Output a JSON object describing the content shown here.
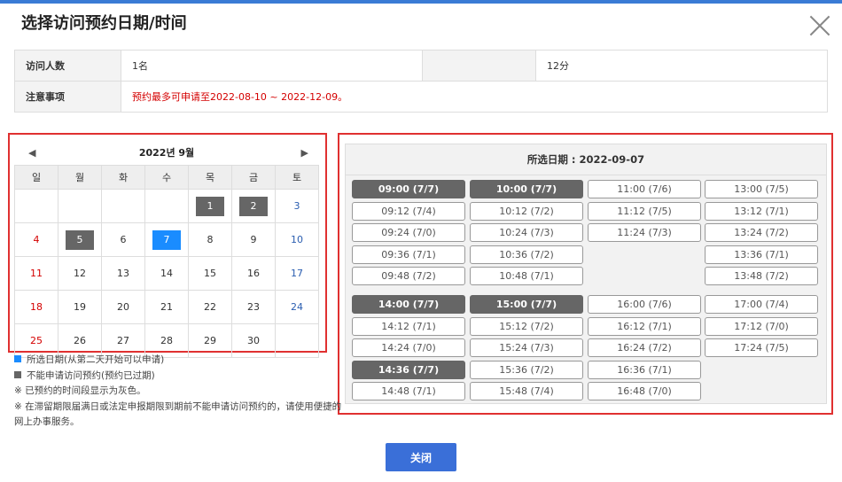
{
  "dialog": {
    "title": "选择访问预约日期/时间"
  },
  "info": {
    "visitors_label": "访问人数",
    "visitors_value": "1名",
    "duration_value": "12分",
    "notes_label": "注意事项",
    "notes_value": "预约最多可申请至2022-08-10 ~ 2022-12-09。"
  },
  "calendar": {
    "prev": "◀",
    "next": "▶",
    "month_title": "2022년 9월",
    "weekdays": [
      "일",
      "월",
      "화",
      "수",
      "목",
      "금",
      "토"
    ],
    "weeks": [
      [
        "",
        "",
        "",
        "",
        "1",
        "2",
        "3"
      ],
      [
        "4",
        "5",
        "6",
        "7",
        "8",
        "9",
        "10"
      ],
      [
        "11",
        "12",
        "13",
        "14",
        "15",
        "16",
        "17"
      ],
      [
        "18",
        "19",
        "20",
        "21",
        "22",
        "23",
        "24"
      ],
      [
        "25",
        "26",
        "27",
        "28",
        "29",
        "30",
        ""
      ]
    ]
  },
  "legend": {
    "selected": "所选日期(从第二天开始可以申请)",
    "unavailable": "不能申请访问预约(预约已过期)",
    "note1": "※ 已预约的时间段显示为灰色。",
    "note2": "※ 在滞留期限届满日或法定申报期限到期前不能申请访问预约的，请使用便捷的网上办事服务。"
  },
  "slots": {
    "header": "所选日期 : 2022-09-07",
    "group1": [
      [
        "09:00 (7/7)",
        "09:12 (7/4)",
        "09:24 (7/0)",
        "09:36 (7/1)",
        "09:48 (7/2)"
      ],
      [
        "10:00 (7/7)",
        "10:12 (7/2)",
        "10:24 (7/3)",
        "10:36 (7/2)",
        "10:48 (7/1)"
      ],
      [
        "11:00 (7/6)",
        "11:12 (7/5)",
        "11:24 (7/3)"
      ],
      [
        "13:00 (7/5)",
        "13:12 (7/1)",
        "13:24 (7/2)",
        "13:36 (7/1)",
        "13:48 (7/2)"
      ]
    ],
    "group2": [
      [
        "14:00 (7/7)",
        "14:12 (7/1)",
        "14:24 (7/0)",
        "14:36 (7/7)",
        "14:48 (7/1)"
      ],
      [
        "15:00 (7/7)",
        "15:12 (7/2)",
        "15:24 (7/3)",
        "15:36 (7/2)",
        "15:48 (7/4)"
      ],
      [
        "16:00 (7/6)",
        "16:12 (7/1)",
        "16:24 (7/2)",
        "16:36 (7/1)",
        "16:48 (7/0)"
      ],
      [
        "17:00 (7/4)",
        "17:12 (7/0)",
        "17:24 (7/5)"
      ]
    ]
  },
  "footer": {
    "close_label": "关闭"
  },
  "colors": {
    "accent": "#3a6fd8",
    "selected": "#1a8cff",
    "unavailable": "#666666",
    "highlight": "#e03030"
  }
}
